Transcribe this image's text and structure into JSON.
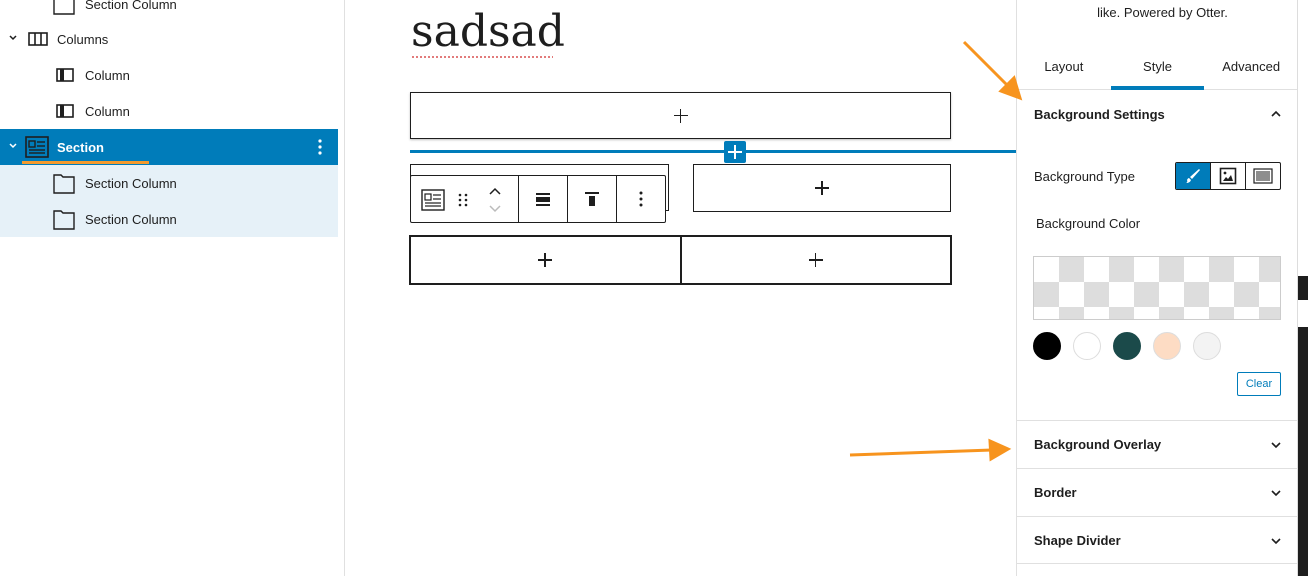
{
  "list_view": {
    "items": [
      {
        "label": "Section Column",
        "icon": "folder-icon",
        "state": "child"
      },
      {
        "label": "Columns",
        "icon": "columns-icon",
        "state": "normal"
      },
      {
        "label": "Column",
        "icon": "column-icon",
        "state": "normal"
      },
      {
        "label": "Column",
        "icon": "column-icon",
        "state": "normal"
      },
      {
        "label": "Section",
        "icon": "section-icon",
        "state": "selected"
      },
      {
        "label": "Section Column",
        "icon": "folder-icon",
        "state": "child-highlight"
      },
      {
        "label": "Section Column",
        "icon": "folder-icon",
        "state": "child-highlight"
      }
    ]
  },
  "canvas": {
    "title": "sadsad",
    "toolbar": {
      "icons": [
        "section-icon",
        "drag-handle-icon",
        "move-up-down-icon",
        "align-icon",
        "vertical-align-top-icon",
        "more-options-icon"
      ]
    }
  },
  "sidebar": {
    "promo_text": "like. Powered by Otter.",
    "tabs": [
      "Layout",
      "Style",
      "Advanced"
    ],
    "active_tab": "Style",
    "panels": {
      "background_settings": "Background Settings",
      "background_type_label": "Background Type",
      "background_color_label": "Background Color",
      "clear_label": "Clear",
      "background_overlay": "Background Overlay",
      "border": "Border",
      "shape_divider": "Shape Divider"
    },
    "background_types": [
      "brush-icon",
      "image-icon",
      "gradient-icon"
    ],
    "swatches": [
      "#000000",
      "#ffffff",
      "#1b4a4a",
      "#fddcc4",
      "#f3f3f3"
    ]
  },
  "colors": {
    "accent": "#007cba",
    "highlight": "#f39a2e",
    "annotation_arrow": "#f7941e"
  }
}
